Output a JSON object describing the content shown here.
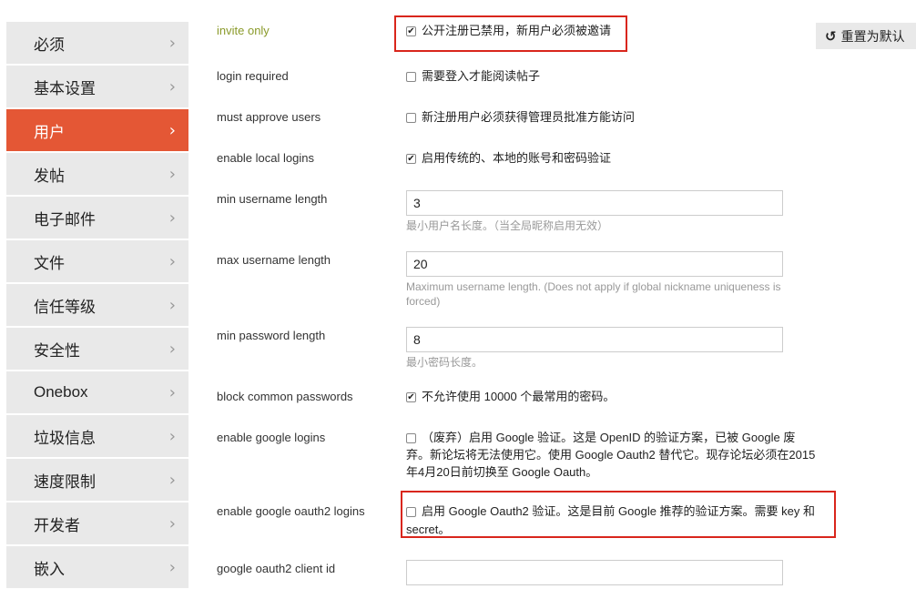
{
  "sidebar": {
    "items": [
      {
        "label": "必须",
        "active": false
      },
      {
        "label": "基本设置",
        "active": false
      },
      {
        "label": "用户",
        "active": true
      },
      {
        "label": "发帖",
        "active": false
      },
      {
        "label": "电子邮件",
        "active": false
      },
      {
        "label": "文件",
        "active": false
      },
      {
        "label": "信任等级",
        "active": false
      },
      {
        "label": "安全性",
        "active": false
      },
      {
        "label": "Onebox",
        "active": false
      },
      {
        "label": "垃圾信息",
        "active": false
      },
      {
        "label": "速度限制",
        "active": false
      },
      {
        "label": "开发者",
        "active": false
      },
      {
        "label": "嵌入",
        "active": false
      }
    ],
    "chevron": "›"
  },
  "reset_button": {
    "label": "重置为默认",
    "icon": "undo-icon"
  },
  "settings": {
    "invite_only": {
      "label": "invite only",
      "checked": true,
      "text": "公开注册已禁用，新用户必须被邀请"
    },
    "login_required": {
      "label": "login required",
      "checked": false,
      "text": "需要登入才能阅读帖子"
    },
    "must_approve_users": {
      "label": "must approve users",
      "checked": false,
      "text": "新注册用户必须获得管理员批准方能访问"
    },
    "enable_local_logins": {
      "label": "enable local logins",
      "checked": true,
      "text": "启用传统的、本地的账号和密码验证"
    },
    "min_username_length": {
      "label": "min username length",
      "value": "3",
      "hint": "最小用户名长度。（当全局昵称启用无效）"
    },
    "max_username_length": {
      "label": "max username length",
      "value": "20",
      "hint": "Maximum username length. (Does not apply if global nickname uniqueness is forced)"
    },
    "min_password_length": {
      "label": "min password length",
      "value": "8",
      "hint": "最小密码长度。"
    },
    "block_common_passwords": {
      "label": "block common passwords",
      "checked": true,
      "text": "不允许使用 10000 个最常用的密码。"
    },
    "enable_google_logins": {
      "label": "enable google logins",
      "checked": false,
      "line1": "（废弃）启用 Google 验证。这是 OpenID 的验证方案，已被 Google 废",
      "line2": "弃。新论坛将无法使用它。使用 Google Oauth2 替代它。现存论坛必须在2015",
      "line3": "年4月20日前切换至 Google Oauth。"
    },
    "enable_google_oauth2_logins": {
      "label": "enable google oauth2 logins",
      "checked": false,
      "line1": "启用 Google Oauth2 验证。这是目前 Google 推荐的验证方案。需要 key 和",
      "line2": "secret。"
    },
    "google_oauth2_client_id": {
      "label": "google oauth2 client id",
      "value": ""
    }
  },
  "colors": {
    "accent": "#e45735",
    "highlight_box": "#d9261c",
    "sidebar_bg": "#e9e9e9"
  }
}
